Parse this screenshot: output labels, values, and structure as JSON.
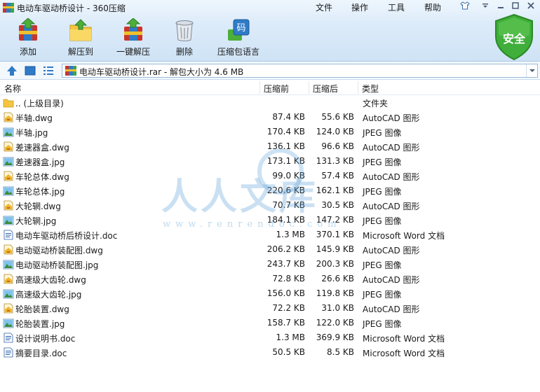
{
  "window": {
    "title": "电动车驱动桥设计 - 360压缩",
    "menu": [
      "文件",
      "操作",
      "工具",
      "帮助"
    ]
  },
  "toolbar": {
    "add": "添加",
    "extract_to": "解压到",
    "one_click_extract": "一键解压",
    "delete": "删除",
    "archive_language": "压缩包语言"
  },
  "security_badge": "安全",
  "address": {
    "text": "电动车驱动桥设计.rar - 解包大小为 4.6 MB"
  },
  "columns": {
    "name": "名称",
    "original_size": "压缩前",
    "packed_size": "压缩后",
    "type": "类型"
  },
  "files": [
    {
      "name": ".. (上级目录)",
      "size": "",
      "packed": "",
      "type": "文件夹",
      "icon": "folder-icon"
    },
    {
      "name": "半轴.dwg",
      "size": "87.4 KB",
      "packed": "55.6 KB",
      "type": "AutoCAD 图形",
      "icon": "dwg-file-icon"
    },
    {
      "name": "半轴.jpg",
      "size": "170.4 KB",
      "packed": "124.0 KB",
      "type": "JPEG 图像",
      "icon": "jpg-file-icon"
    },
    {
      "name": "差速器盒.dwg",
      "size": "136.1 KB",
      "packed": "96.6 KB",
      "type": "AutoCAD 图形",
      "icon": "dwg-file-icon"
    },
    {
      "name": "差速器盒.jpg",
      "size": "173.1 KB",
      "packed": "131.3 KB",
      "type": "JPEG 图像",
      "icon": "jpg-file-icon"
    },
    {
      "name": "车轮总体.dwg",
      "size": "99.0 KB",
      "packed": "57.4 KB",
      "type": "AutoCAD 图形",
      "icon": "dwg-file-icon"
    },
    {
      "name": "车轮总体.jpg",
      "size": "220.6 KB",
      "packed": "162.1 KB",
      "type": "JPEG 图像",
      "icon": "jpg-file-icon"
    },
    {
      "name": "大轮辋.dwg",
      "size": "70.7 KB",
      "packed": "30.5 KB",
      "type": "AutoCAD 图形",
      "icon": "dwg-file-icon"
    },
    {
      "name": "大轮辋.jpg",
      "size": "184.1 KB",
      "packed": "147.2 KB",
      "type": "JPEG 图像",
      "icon": "jpg-file-icon"
    },
    {
      "name": "电动车驱动桥后桥设计.doc",
      "size": "1.3 MB",
      "packed": "370.1 KB",
      "type": "Microsoft Word 文档",
      "icon": "doc-file-icon"
    },
    {
      "name": "电动驱动桥装配图.dwg",
      "size": "206.2 KB",
      "packed": "145.9 KB",
      "type": "AutoCAD 图形",
      "icon": "dwg-file-icon"
    },
    {
      "name": "电动驱动桥装配图.jpg",
      "size": "243.7 KB",
      "packed": "200.3 KB",
      "type": "JPEG 图像",
      "icon": "jpg-file-icon"
    },
    {
      "name": "高速级大齿轮.dwg",
      "size": "72.8 KB",
      "packed": "26.6 KB",
      "type": "AutoCAD 图形",
      "icon": "dwg-file-icon"
    },
    {
      "name": "高速级大齿轮.jpg",
      "size": "156.0 KB",
      "packed": "119.8 KB",
      "type": "JPEG 图像",
      "icon": "jpg-file-icon"
    },
    {
      "name": "轮胎装置.dwg",
      "size": "72.2 KB",
      "packed": "31.0 KB",
      "type": "AutoCAD 图形",
      "icon": "dwg-file-icon"
    },
    {
      "name": "轮胎装置.jpg",
      "size": "158.7 KB",
      "packed": "122.0 KB",
      "type": "JPEG 图像",
      "icon": "jpg-file-icon"
    },
    {
      "name": "设计说明书.doc",
      "size": "1.3 MB",
      "packed": "369.9 KB",
      "type": "Microsoft Word 文档",
      "icon": "doc-file-icon"
    },
    {
      "name": "摘要目录.doc",
      "size": "50.5 KB",
      "packed": "8.5 KB",
      "type": "Microsoft Word 文档",
      "icon": "doc-file-icon"
    }
  ],
  "watermark": {
    "text": "人人文库",
    "url": "www.renrendoc.com"
  }
}
